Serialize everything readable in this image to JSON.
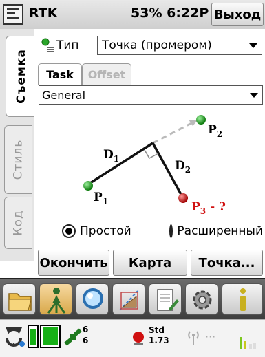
{
  "titlebar": {
    "app_title": "RTK",
    "status": "53% 6:22P",
    "exit_label": "Выход",
    "start_icon": "windows-start-icon"
  },
  "side_tabs": [
    {
      "label": "Съемка",
      "active": true
    },
    {
      "label": "Стиль",
      "active": false
    },
    {
      "label": "Код",
      "active": false
    }
  ],
  "type_row": {
    "label": "Тип",
    "value": "Точка (промером)",
    "icon": "point-type-icon"
  },
  "tabs": [
    {
      "label": "Task",
      "active": true
    },
    {
      "label": "Offset",
      "active": false
    }
  ],
  "preset": {
    "value": "General"
  },
  "diagram": {
    "d1": "D",
    "d1_sub": "1",
    "d2": "D",
    "d2_sub": "2",
    "p1": "P",
    "p1_sub": "1",
    "p2": "P",
    "p2_sub": "2",
    "p3": "P",
    "p3_sub": "3",
    "p3_suffix": " - ?",
    "colors": {
      "known_point": "#1f9a1f",
      "unknown_point": "#d01010",
      "guide": "#bbbbbb"
    }
  },
  "mode": [
    {
      "label": "Простой",
      "selected": true
    },
    {
      "label": "Расширенный",
      "selected": false
    }
  ],
  "actions": {
    "finish": "Окончить",
    "map": "Карта",
    "point": "Точка..."
  },
  "toolbar_icons": [
    "folder-icon",
    "surveyor-icon",
    "magnifier-icon",
    "cogo-icon",
    "notebook-icon",
    "settings-gear-icon",
    "info-icon"
  ],
  "statusbar": {
    "sat_top": "6",
    "sat_bottom": "6",
    "solution": "Std",
    "precision": "1.73",
    "dots": "···"
  }
}
